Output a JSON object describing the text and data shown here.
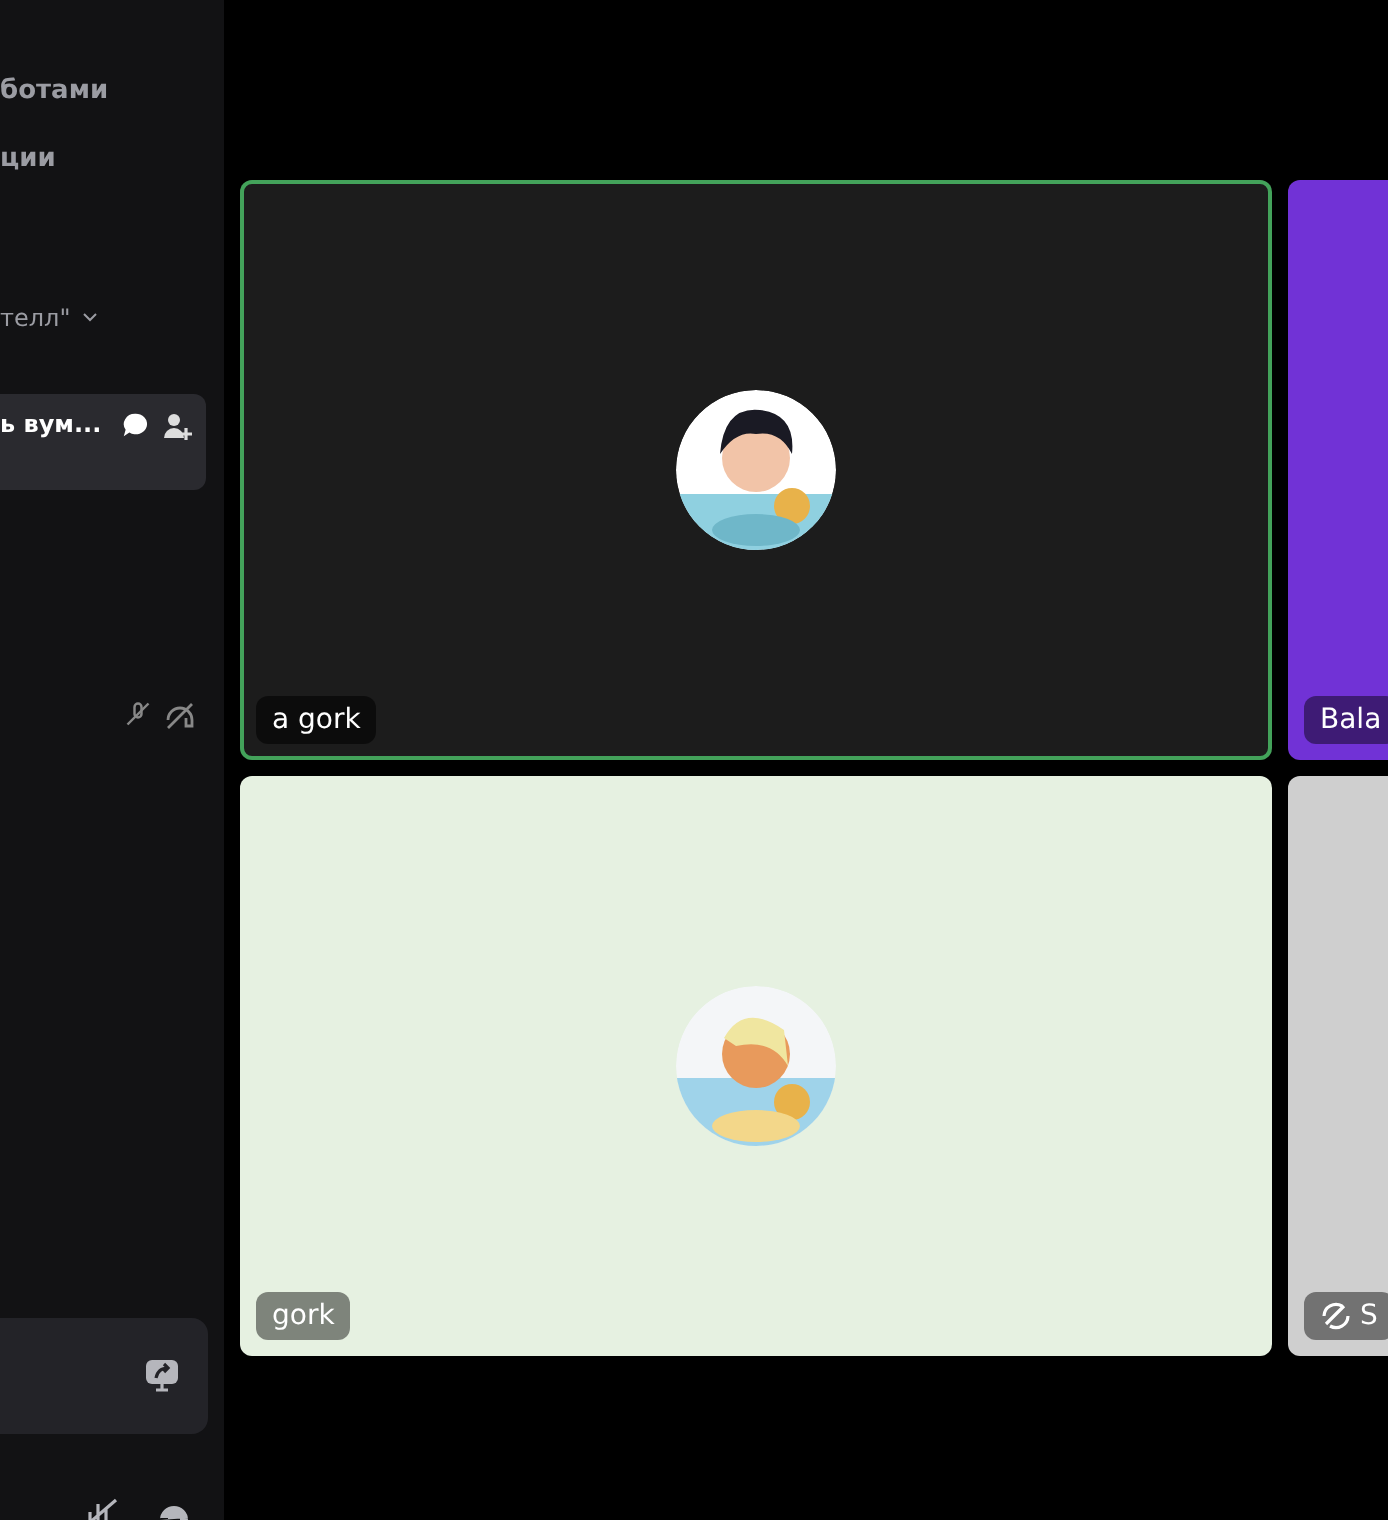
{
  "sidebar": {
    "items": [
      {
        "kind": "link",
        "label": "ботами"
      },
      {
        "kind": "link",
        "label": "ции"
      },
      {
        "kind": "category",
        "label": "телл\"",
        "expanded": true
      },
      {
        "kind": "channel",
        "label": "ь вум...",
        "selected": true
      },
      {
        "kind": "user-icons"
      }
    ],
    "panel": {
      "kind": "screen-share"
    }
  },
  "tiles": [
    {
      "kind": "avatar",
      "name": "a gork",
      "color": "#1c1c1c",
      "speaking": true
    },
    {
      "kind": "plain",
      "name": "Bala",
      "color": "#7132d6",
      "speaking": false
    },
    {
      "kind": "avatar",
      "name": "gork",
      "color": "#e6f1e1",
      "speaking": false
    },
    {
      "kind": "video-off",
      "name": "S",
      "color": "#cfcfcf",
      "speaking": false
    }
  ]
}
